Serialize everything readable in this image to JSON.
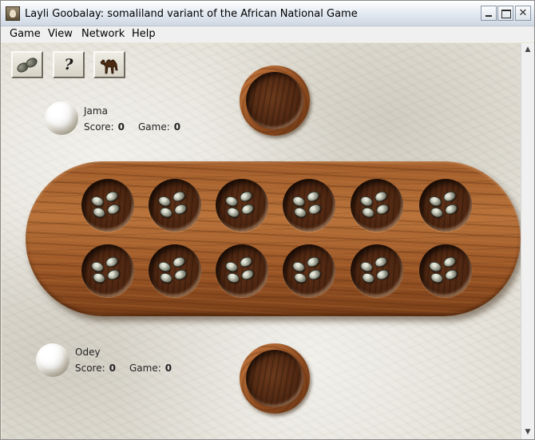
{
  "window": {
    "title": "Layli Goobalay: somaliland variant of the African National Game",
    "icon": "app-icon",
    "buttons": {
      "minimize": "minimize",
      "maximize": "maximize",
      "close": "close"
    }
  },
  "menu": [
    {
      "label": "Game"
    },
    {
      "label": "View"
    },
    {
      "label": "Network"
    },
    {
      "label": "Help"
    }
  ],
  "toolbar": {
    "help_glyph": "?",
    "icons": [
      "seeds-icon",
      "help-icon",
      "camel-icon"
    ]
  },
  "players": {
    "top": {
      "name": "Jama",
      "score_label": "Score:",
      "score": "0",
      "game_label": "Game:",
      "game": "0"
    },
    "bottom": {
      "name": "Odey",
      "score_label": "Score:",
      "score": "0",
      "game_label": "Game:",
      "game": "0"
    }
  },
  "board": {
    "rows": [
      {
        "row": "top",
        "pits": [
          4,
          4,
          4,
          4,
          4,
          4
        ]
      },
      {
        "row": "bottom",
        "pits": [
          4,
          4,
          4,
          4,
          4,
          4
        ]
      }
    ],
    "stores": {
      "top": 0,
      "bottom": 0
    }
  },
  "colors": {
    "wood": "#9b5626",
    "pit": "#4a2410",
    "stone": "#a9ac9c",
    "marble": "#e4e1d8"
  }
}
